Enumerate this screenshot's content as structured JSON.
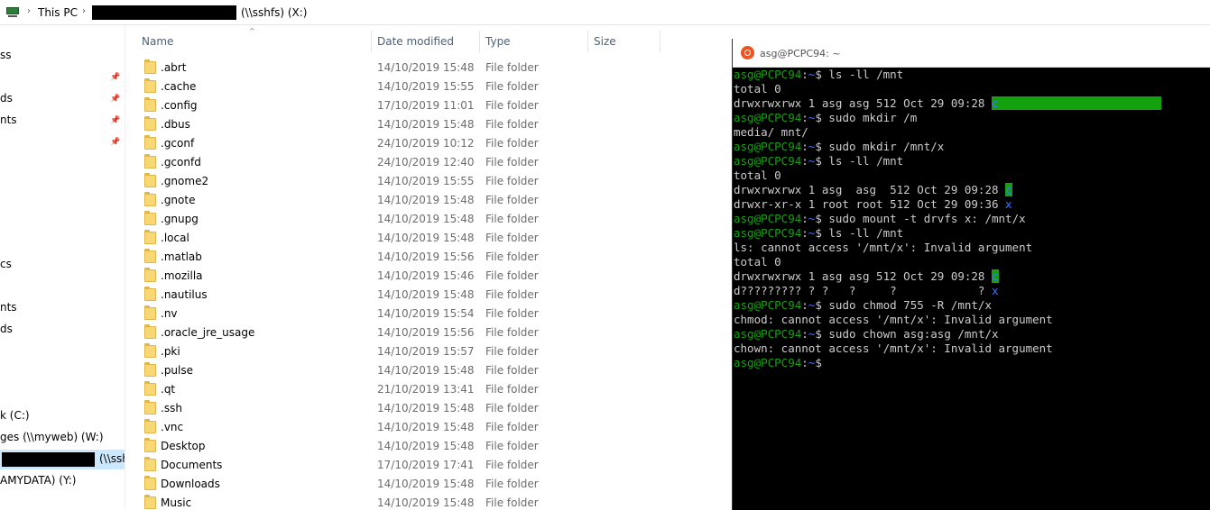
{
  "address_bar": {
    "this_pc": "This PC",
    "location_suffix": "(\\\\sshfs) (X:)"
  },
  "nav": {
    "items": [
      {
        "label": "ss"
      },
      {
        "label": "ds"
      },
      {
        "label": "nts"
      },
      {
        "label": "cs"
      },
      {
        "label": "nts"
      },
      {
        "label": "ds"
      },
      {
        "label": "k (C:)"
      },
      {
        "label": "ges (\\\\myweb) (W:)"
      },
      {
        "label": "(\\\\ssh"
      },
      {
        "label": "AMYDATA) (Y:)"
      }
    ]
  },
  "columns": {
    "name": "Name",
    "date": "Date modified",
    "type": "Type",
    "size": "Size"
  },
  "files": [
    {
      "name": ".abrt",
      "date": "14/10/2019 15:48",
      "type": "File folder"
    },
    {
      "name": ".cache",
      "date": "14/10/2019 15:55",
      "type": "File folder"
    },
    {
      "name": ".config",
      "date": "17/10/2019 11:01",
      "type": "File folder"
    },
    {
      "name": ".dbus",
      "date": "14/10/2019 15:48",
      "type": "File folder"
    },
    {
      "name": ".gconf",
      "date": "24/10/2019 10:12",
      "type": "File folder"
    },
    {
      "name": ".gconfd",
      "date": "24/10/2019 12:40",
      "type": "File folder"
    },
    {
      "name": ".gnome2",
      "date": "14/10/2019 15:55",
      "type": "File folder"
    },
    {
      "name": ".gnote",
      "date": "14/10/2019 15:48",
      "type": "File folder"
    },
    {
      "name": ".gnupg",
      "date": "14/10/2019 15:48",
      "type": "File folder"
    },
    {
      "name": ".local",
      "date": "14/10/2019 15:48",
      "type": "File folder"
    },
    {
      "name": ".matlab",
      "date": "14/10/2019 15:56",
      "type": "File folder"
    },
    {
      "name": ".mozilla",
      "date": "14/10/2019 15:46",
      "type": "File folder"
    },
    {
      "name": ".nautilus",
      "date": "14/10/2019 15:48",
      "type": "File folder"
    },
    {
      "name": ".nv",
      "date": "14/10/2019 15:54",
      "type": "File folder"
    },
    {
      "name": ".oracle_jre_usage",
      "date": "14/10/2019 15:56",
      "type": "File folder"
    },
    {
      "name": ".pki",
      "date": "14/10/2019 15:57",
      "type": "File folder"
    },
    {
      "name": ".pulse",
      "date": "14/10/2019 15:48",
      "type": "File folder"
    },
    {
      "name": ".qt",
      "date": "21/10/2019 13:41",
      "type": "File folder"
    },
    {
      "name": ".ssh",
      "date": "14/10/2019 15:48",
      "type": "File folder"
    },
    {
      "name": ".vnc",
      "date": "14/10/2019 15:48",
      "type": "File folder"
    },
    {
      "name": "Desktop",
      "date": "14/10/2019 15:48",
      "type": "File folder"
    },
    {
      "name": "Documents",
      "date": "17/10/2019 17:41",
      "type": "File folder"
    },
    {
      "name": "Downloads",
      "date": "14/10/2019 15:48",
      "type": "File folder"
    },
    {
      "name": "Music",
      "date": "14/10/2019 15:48",
      "type": "File folder"
    }
  ],
  "terminal": {
    "title": "asg@PCPC94: ~",
    "prompt_user": "asg@PCPC94",
    "prompt_sep": ":",
    "prompt_path": "~",
    "prompt_end": "$ ",
    "lines": [
      {
        "kind": "cmd",
        "text": "ls -ll /mnt"
      },
      {
        "kind": "out",
        "text": "total 0"
      },
      {
        "kind": "out",
        "text": "drwxrwxrwx 1 asg asg 512 Oct 29 09:28 ",
        "tail": "c",
        "tail_style": "hl-green",
        "tail_pad": "                        "
      },
      {
        "kind": "cmd",
        "text": "sudo mkdir /m"
      },
      {
        "kind": "out",
        "text": "media/ mnt/"
      },
      {
        "kind": "cmd",
        "text": "sudo mkdir /mnt/x"
      },
      {
        "kind": "cmd",
        "text": "ls -ll /mnt"
      },
      {
        "kind": "out",
        "text": "total 0"
      },
      {
        "kind": "out",
        "text": "drwxrwxrwx 1 asg  asg  512 Oct 29 09:28 ",
        "tail": "c",
        "tail_style": "hl-green"
      },
      {
        "kind": "out",
        "text": "drwxr-xr-x 1 root root 512 Oct 29 09:36 ",
        "tail": "x",
        "tail_style": "blue"
      },
      {
        "kind": "cmd",
        "text": "sudo mount -t drvfs x: /mnt/x"
      },
      {
        "kind": "cmd",
        "text": "ls -ll /mnt"
      },
      {
        "kind": "out",
        "text": "ls: cannot access '/mnt/x': Invalid argument"
      },
      {
        "kind": "out",
        "text": "total 0"
      },
      {
        "kind": "out",
        "text": "drwxrwxrwx 1 asg asg 512 Oct 29 09:28 ",
        "tail": "c",
        "tail_style": "hl-green"
      },
      {
        "kind": "out",
        "text": "d????????? ? ?   ?     ?            ? ",
        "tail": "x",
        "tail_style": "blue"
      },
      {
        "kind": "cmd",
        "text": "sudo chmod 755 -R /mnt/x"
      },
      {
        "kind": "out",
        "text": "chmod: cannot access '/mnt/x': Invalid argument"
      },
      {
        "kind": "cmd",
        "text": "sudo chown asg:asg /mnt/x"
      },
      {
        "kind": "out",
        "text": "chown: cannot access '/mnt/x': Invalid argument"
      },
      {
        "kind": "cmd",
        "text": ""
      }
    ]
  }
}
